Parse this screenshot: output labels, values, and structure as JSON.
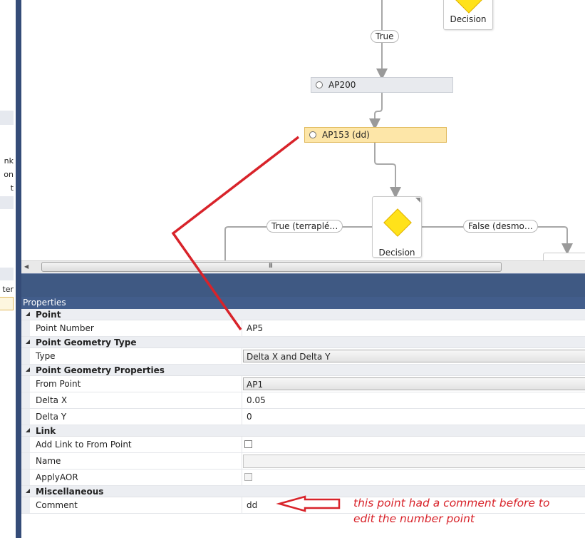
{
  "left_panel": {
    "fragments": [
      "nk",
      "on",
      "t",
      "ter"
    ]
  },
  "canvas": {
    "nodes": {
      "decision_top": "Decision",
      "ap200": "AP200",
      "ap153": "AP153 (dd)",
      "decision_main": "Decision"
    },
    "connector_labels": {
      "true": "True",
      "true_terraple": "True (terraplé…",
      "false_desmo": "False (desmo…"
    }
  },
  "scrollbar": {
    "grip": "III"
  },
  "properties": {
    "header": "Properties",
    "categories": [
      {
        "name": "Point",
        "rows": [
          {
            "label": "Point Number",
            "value": "AP5",
            "kind": "text"
          }
        ]
      },
      {
        "name": "Point Geometry Type",
        "rows": [
          {
            "label": "Type",
            "value": "Delta X and Delta Y",
            "kind": "combo"
          }
        ]
      },
      {
        "name": "Point Geometry Properties",
        "rows": [
          {
            "label": "From Point",
            "value": "AP1",
            "kind": "combo"
          },
          {
            "label": "Delta X",
            "value": "0.05",
            "kind": "text"
          },
          {
            "label": "Delta Y",
            "value": "0",
            "kind": "text"
          }
        ]
      },
      {
        "name": "Link",
        "rows": [
          {
            "label": "Add Link to From Point",
            "value": "",
            "kind": "checkbox"
          },
          {
            "label": "Name",
            "value": "",
            "kind": "disabled-text"
          },
          {
            "label": "ApplyAOR",
            "value": "",
            "kind": "disabled-checkbox"
          }
        ]
      },
      {
        "name": "Miscellaneous",
        "rows": [
          {
            "label": "Comment",
            "value": "dd",
            "kind": "text"
          }
        ]
      }
    ]
  },
  "annotation": {
    "note_line1": "this point had a comment before to",
    "note_line2": "edit the number point",
    "color": "#d8232a"
  },
  "colors": {
    "splitter": "#3f5983",
    "selected_node": "#fde6a8",
    "decision_diamond": "#ffe21a"
  }
}
